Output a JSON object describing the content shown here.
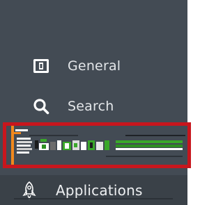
{
  "sidebar": {
    "items": [
      {
        "label": "General",
        "icon": "general-settings-icon"
      },
      {
        "label": "Search",
        "icon": "search-icon"
      },
      {
        "label": "",
        "icon": "garbled-item-icon"
      },
      {
        "label": "Applications",
        "icon": "rocket-icon"
      }
    ],
    "selected_index": 2
  },
  "colors": {
    "sidebar_bg": "#434b54",
    "text": "#e3e6e9",
    "accent": "#f2891d",
    "highlight_box": "#c8161d",
    "glitch_green": "#3aa82a"
  }
}
